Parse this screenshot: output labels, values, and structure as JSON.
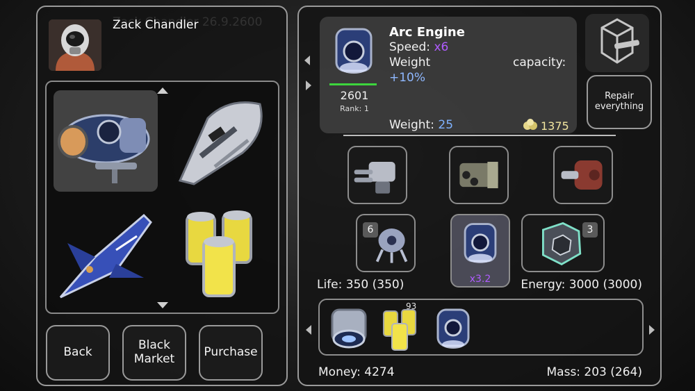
{
  "pilot": {
    "name": "Zack Chandler",
    "ghost": "Zack Chandler 26.9.2600"
  },
  "buttons": {
    "back": "Back",
    "black_market": "Black\nMarket",
    "purchase": "Purchase",
    "repair": "Repair\neverything"
  },
  "detail": {
    "name": "Arc Engine",
    "speed_label": "Speed:",
    "speed_value": "x6",
    "weight_label": "Weight",
    "weight_pct": "+10%",
    "capacity_label": "capacity:",
    "id": "2601",
    "rank": "Rank: 1",
    "weight_val_label": "Weight:",
    "weight_val": "25",
    "price": "1375"
  },
  "slots": {
    "badge_left": "6",
    "badge_right": "3",
    "selected_mult": "x3.2"
  },
  "stats": {
    "life": "Life: 350 (350)",
    "energy": "Energy: 3000 (3000)",
    "money": "Money: 4274",
    "mass": "Mass: 203 (264)"
  },
  "cargo": {
    "qty": "93"
  },
  "colors": {
    "accent_purple": "#b05cff",
    "accent_blue": "#7fb2ff",
    "health_green": "#3dd63d",
    "coin_yellow": "#f2e6a0"
  }
}
